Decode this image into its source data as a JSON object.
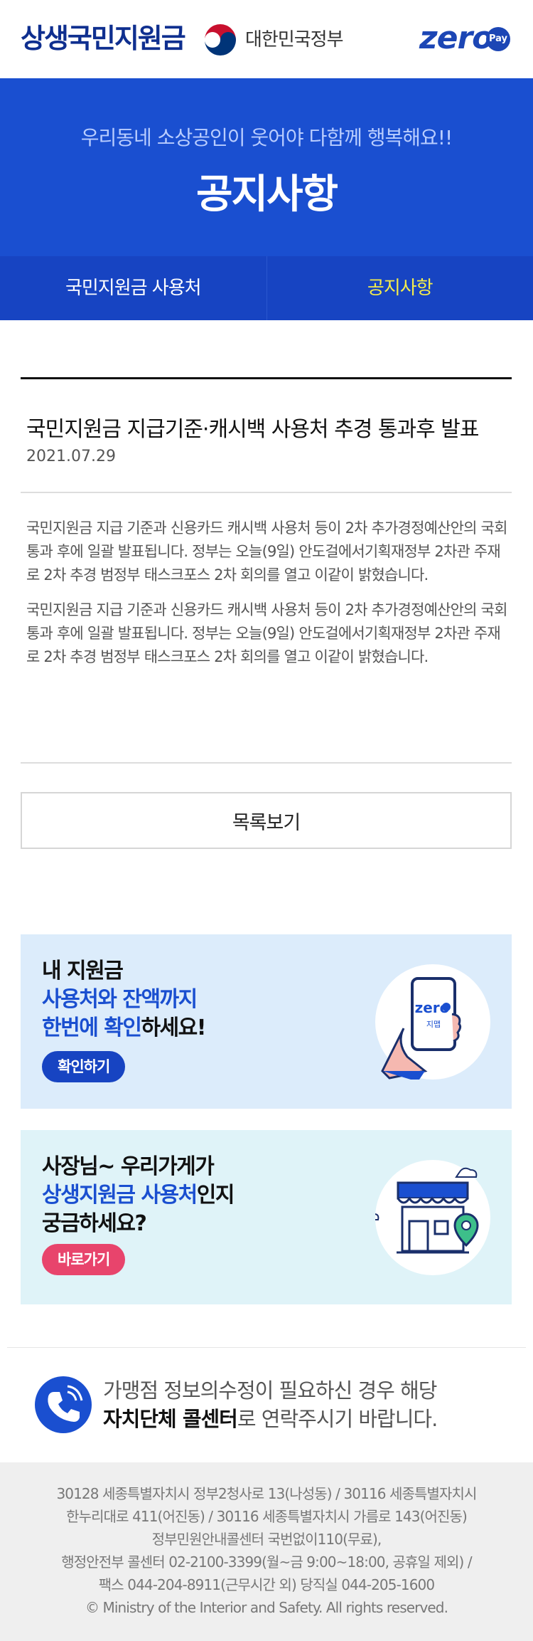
{
  "header": {
    "site_title": "상생국민지원금",
    "gov_name": "대한민국정부",
    "zero_logo": "zero",
    "zero_pay": "Pay"
  },
  "hero": {
    "subtitle": "우리동네 소상공인이 웃어야 다함께 행복해요!!",
    "title": "공지사항"
  },
  "tabs": [
    {
      "label": "국민지원금 사용처",
      "active": false
    },
    {
      "label": "공지사항",
      "active": true
    }
  ],
  "notice": {
    "title": "국민지원금 지급기준·캐시백 사용처 추경 통과후 발표",
    "date": "2021.07.29",
    "paragraphs": [
      "국민지원금 지급 기준과 신용카드 캐시백 사용처 등이 2차 추가경정예산안의 국회 통과 후에 일괄 발표됩니다. 정부는 오늘(9일) 안도걸에서기획재정부 2차관 주재로 2차 추경 범정부 태스크포스 2차 회의를 열고 이같이 밝혔습니다.",
      "국민지원금 지급 기준과 신용카드 캐시백 사용처 등이 2차 추가경정예산안의 국회 통과 후에 일괄 발표됩니다. 정부는 오늘(9일) 안도걸에서기획재정부 2차관 주재로 2차 추경 범정부 태스크포스 2차 회의를 열고 이같이 밝혔습니다."
    ],
    "list_button": "목록보기"
  },
  "banner1": {
    "line1": "내 지원금",
    "line2_hl": "사용처와 잔액까지",
    "line3_hl": "한번에 확인",
    "line3_rest": "하세요!",
    "button": "확인하기",
    "phone_logo": "zero",
    "phone_sub": "지맵"
  },
  "banner2": {
    "line1": "사장님~ 우리가게가",
    "line2_hl": "상생지원금 사용처",
    "line2_rest": "인지",
    "line3": "궁금하세요?",
    "button": "바로가기"
  },
  "callcenter": {
    "line1": "가맹점 정보의수정이 필요하신 경우 해당",
    "line2_bold": "자치단체 콜센터",
    "line2_rest": "로 연락주시기 바랍니다."
  },
  "footer": {
    "lines": [
      "30128 세종특별자치시 정부2청사로 13(나성동) / 30116 세종특별자치시",
      "한누리대로 411(어진동) / 30116 세종특별자치시 가름로 143(어진동)",
      "정부민원안내콜센터 국번없이110(무료),",
      "행정안전부 콜센터 02-2100-3399(월~금 9:00~18:00, 공휴일 제외) /",
      "팩스 044-204-8911(근무시간 외) 당직실 044-205-1600",
      "© Ministry of the Interior and Safety. All rights reserved."
    ]
  },
  "colors": {
    "brand_blue": "#1a4fd0",
    "tab_active": "#f4ec4b",
    "pink": "#e8446c"
  }
}
